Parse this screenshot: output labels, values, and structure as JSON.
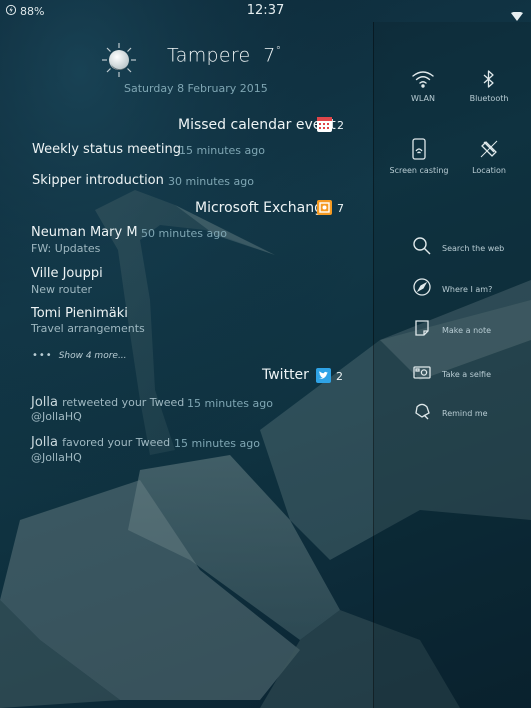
{
  "status": {
    "battery": "88%",
    "time": "12:37"
  },
  "weather": {
    "city": "Tampere",
    "temperature": "7",
    "degree": "°",
    "date": "Saturday 8 February 2015"
  },
  "calendar": {
    "title": "Missed calendar event",
    "count": "2",
    "items": [
      {
        "title": "Weekly status meeting",
        "time": "15 minutes ago"
      },
      {
        "title": "Skipper introduction",
        "time": "30 minutes ago"
      }
    ]
  },
  "exchange": {
    "title": "Microsoft Exchange",
    "count": "7",
    "items": [
      {
        "title": "Neuman Mary M",
        "time": "50 minutes ago",
        "subtitle": "FW: Updates"
      },
      {
        "title": "Ville Jouppi",
        "subtitle": "New router"
      },
      {
        "title": "Tomi Pienimäki",
        "subtitle": "Travel arrangements"
      }
    ],
    "show_more": "Show 4 more..."
  },
  "twitter": {
    "title": "Twitter",
    "count": "2",
    "items": [
      {
        "name": "Jolla",
        "action": "retweeted your Tweed",
        "time": "15 minutes ago",
        "handle": "@JollaHQ"
      },
      {
        "name": "Jolla",
        "action": "favored your Tweed",
        "time": "15 minutes ago",
        "handle": "@JollaHQ"
      }
    ]
  },
  "quick_settings": {
    "wlan": "WLAN",
    "bluetooth": "Bluetooth",
    "screen_casting": "Screen casting",
    "location": "Location"
  },
  "actions": {
    "search": "Search the web",
    "where": "Where I am?",
    "note": "Make a note",
    "selfie": "Take a selfie",
    "remind": "Remind me"
  },
  "colors": {
    "calendar": "#e0464a",
    "exchange": "#f59b23",
    "twitter": "#2fa3e6",
    "secondary_text": "#7fa6b3"
  }
}
